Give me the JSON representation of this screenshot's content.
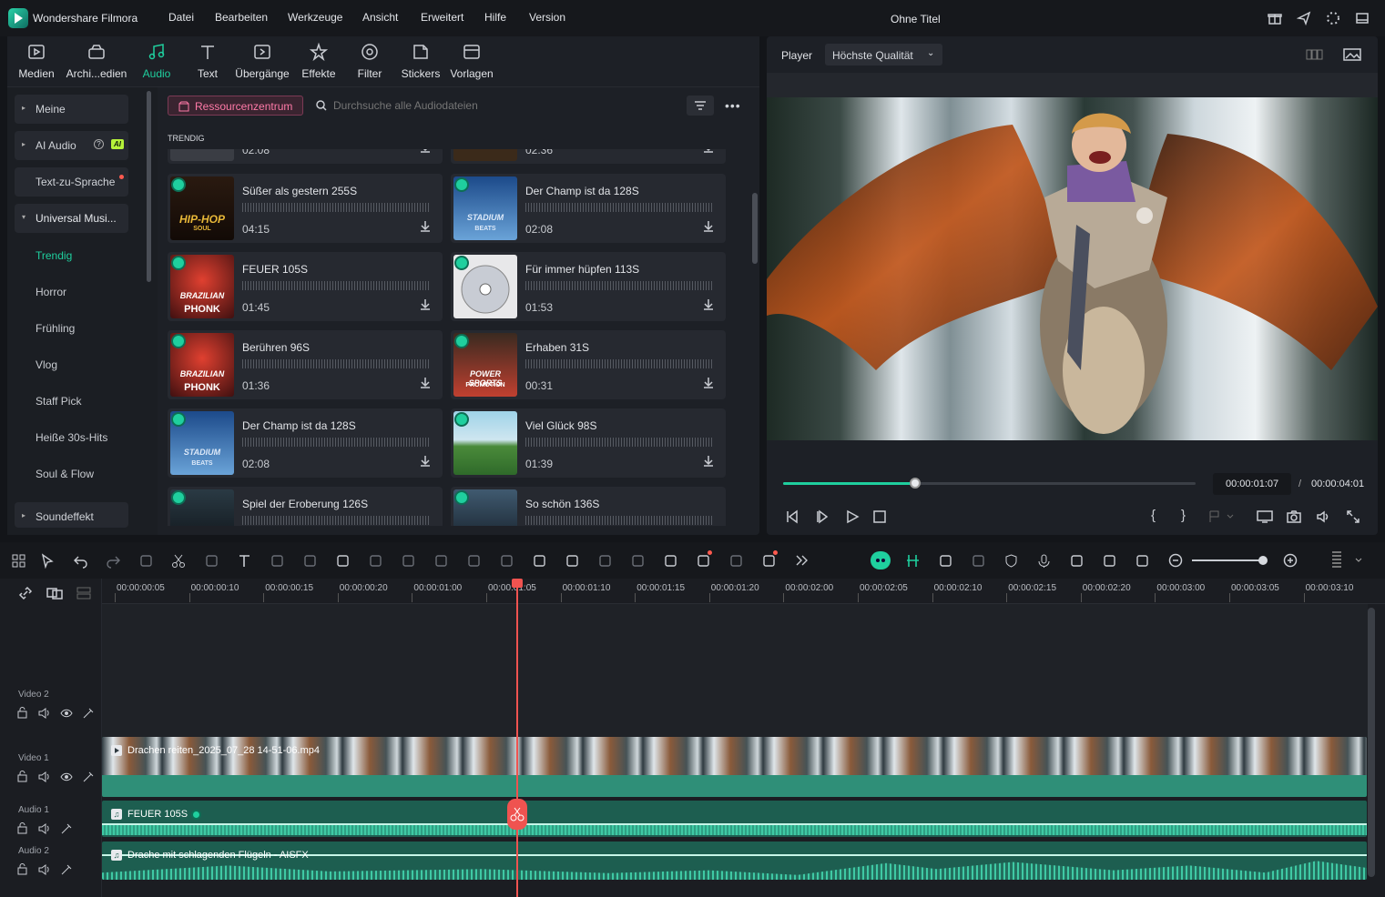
{
  "app": {
    "name": "Wondershare Filmora",
    "doc_title": "Ohne Titel"
  },
  "menu": [
    "Datei",
    "Bearbeiten",
    "Werkzeuge",
    "Ansicht",
    "Erweitert",
    "Hilfe",
    "Version"
  ],
  "toolbar": [
    {
      "label": "Medien",
      "icon": "media-icon"
    },
    {
      "label": "Archi...edien",
      "icon": "archive-icon"
    },
    {
      "label": "Audio",
      "icon": "music-note-icon",
      "active": true
    },
    {
      "label": "Text",
      "icon": "text-icon"
    },
    {
      "label": "Übergänge",
      "icon": "transition-icon"
    },
    {
      "label": "Effekte",
      "icon": "effects-icon"
    },
    {
      "label": "Filter",
      "icon": "filter-icon"
    },
    {
      "label": "Stickers",
      "icon": "sticker-icon"
    },
    {
      "label": "Vorlagen",
      "icon": "template-icon"
    }
  ],
  "sidebar": {
    "meine": "Meine",
    "ai_audio": "AI Audio",
    "ai_badge": "AI",
    "tts": "Text-zu-Sprache",
    "universal": "Universal Musi...",
    "subs": [
      "Trendig",
      "Horror",
      "Frühling",
      "Vlog",
      "Staff Pick",
      "Heiße 30s-Hits",
      "Soul & Flow"
    ],
    "soundeffekt": "Soundeffekt"
  },
  "library": {
    "resource_btn": "Ressourcenzentrum",
    "search_placeholder": "Durchsuche alle Audiodateien",
    "section": "TRENDIG",
    "top_left_dur": "02:08",
    "top_right_dur": "02:36"
  },
  "tracks": [
    {
      "title": "Süßer als gestern 255S",
      "dur": "04:15",
      "thumb": "hiphop"
    },
    {
      "title": "Der Champ ist da 128S",
      "dur": "02:08",
      "thumb": "stadium"
    },
    {
      "title": "FEUER 105S",
      "dur": "01:45",
      "thumb": "phonk"
    },
    {
      "title": "Für immer hüpfen 113S",
      "dur": "01:53",
      "thumb": "cd"
    },
    {
      "title": "Berühren 96S",
      "dur": "01:36",
      "thumb": "phonk"
    },
    {
      "title": "Erhaben 31S",
      "dur": "00:31",
      "thumb": "sports"
    },
    {
      "title": "Der Champ ist da 128S",
      "dur": "02:08",
      "thumb": "stadium"
    },
    {
      "title": "Viel Glück 98S",
      "dur": "01:39",
      "thumb": "landscape"
    },
    {
      "title": "Spiel der Eroberung 126S",
      "dur": "",
      "thumb": "dark"
    },
    {
      "title": "So schön 136S",
      "dur": "",
      "thumb": "city"
    }
  ],
  "thumb_text": {
    "hiphop1": "HIP-HOP",
    "hiphop2": "SOUL",
    "stadium1": "STADIUM",
    "stadium2": "BEATS",
    "phonk1": "BRAZILIAN",
    "phonk2": "PHONK",
    "sports1": "POWER SPORTS",
    "sports2": "PROMOTION"
  },
  "player": {
    "label": "Player",
    "quality": "Höchste Qualität",
    "current": "00:00:01:07",
    "sep": "/",
    "total": "00:00:04:01",
    "progress": 0.32
  },
  "timeline": {
    "ruler": [
      "00:00:00:05",
      "00:00:00:10",
      "00:00:00:15",
      "00:00:00:20",
      "00:00:01:00",
      "00:00:01:05",
      "00:00:01:10",
      "00:00:01:15",
      "00:00:01:20",
      "00:00:02:00",
      "00:00:02:05",
      "00:00:02:10",
      "00:00:02:15",
      "00:00:02:20",
      "00:00:03:00",
      "00:00:03:05",
      "00:00:03:10"
    ],
    "track_labels": {
      "video2": "Video 2",
      "video1": "Video 1",
      "audio1": "Audio 1",
      "audio2": "Audio 2"
    },
    "video_clip": "Drachen reiten_2025_07_28 14-51-06.mp4",
    "audio1_clip": "FEUER 105S",
    "audio2_clip": "Drache mit schlagenden Flügeln - AISFX"
  },
  "colors": {
    "accent": "#1fcf9e",
    "playhead": "#ef5350",
    "clip": "#2f8f78"
  }
}
